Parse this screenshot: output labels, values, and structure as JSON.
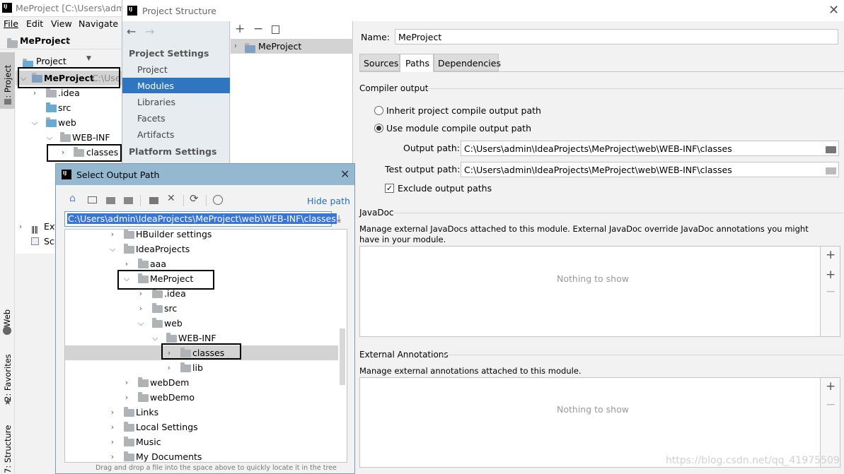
{
  "ide": {
    "title": "MeProject [C:\\Users\\adm",
    "menu": [
      "File",
      "Edit",
      "View",
      "Navigate"
    ],
    "breadcrumb": "MeProject",
    "project_view_label": "Project",
    "tree": {
      "root_name": "MeProject",
      "root_path": "C:\\Use",
      "items": [
        ".idea",
        "src",
        "web",
        "WEB-INF",
        "classes"
      ],
      "ext_label": "Ext",
      "scr_label": "Scr"
    },
    "side_tabs": {
      "project": "1: Project",
      "web": "Web",
      "favorites": "2: Favorites",
      "structure": "7: Structure"
    }
  },
  "ps": {
    "title": "Project Structure",
    "project_settings_header": "Project Settings",
    "nav_items": [
      "Project",
      "Modules",
      "Libraries",
      "Facets",
      "Artifacts"
    ],
    "platform_settings_header": "Platform Settings",
    "module_name": "MeProject",
    "name_label": "Name:",
    "name_value": "MeProject",
    "tabs": [
      "Sources",
      "Paths",
      "Dependencies"
    ],
    "compiler_output_header": "Compiler output",
    "inherit_label": "Inherit project compile output path",
    "use_module_label": "Use module compile output path",
    "output_path_label": "Output path:",
    "output_path_value": "C:\\Users\\admin\\IdeaProjects\\MeProject\\web\\WEB-INF\\classes",
    "test_output_path_label": "Test output path:",
    "test_output_path_value": "C:\\Users\\admin\\IdeaProjects\\MeProject\\web\\WEB-INF\\classes",
    "exclude_label": "Exclude output paths",
    "javadoc_header": "JavaDoc",
    "javadoc_desc": "Manage external JavaDocs attached to this module. External JavaDoc override JavaDoc annotations you might have in your module.",
    "nothing_to_show": "Nothing to show",
    "ext_annotations_header": "External Annotations",
    "ext_annotations_desc": "Manage external annotations attached to this module."
  },
  "sop": {
    "title": "Select Output Path",
    "hide_path": "Hide path",
    "path_value": "C:\\Users\\admin\\IdeaProjects\\MeProject\\web\\WEB-INF\\classes",
    "tree": [
      "HBuilder settings",
      "IdeaProjects",
      "aaa",
      "MeProject",
      ".idea",
      "src",
      "web",
      "WEB-INF",
      "classes",
      "lib",
      "webDem",
      "webDemo",
      "Links",
      "Local Settings",
      "Music",
      "My Documents"
    ],
    "footer": "Drag and drop a file into the space above to quickly locate it in the tree"
  },
  "watermark": "https://blog.csdn.net/qq_41975509"
}
